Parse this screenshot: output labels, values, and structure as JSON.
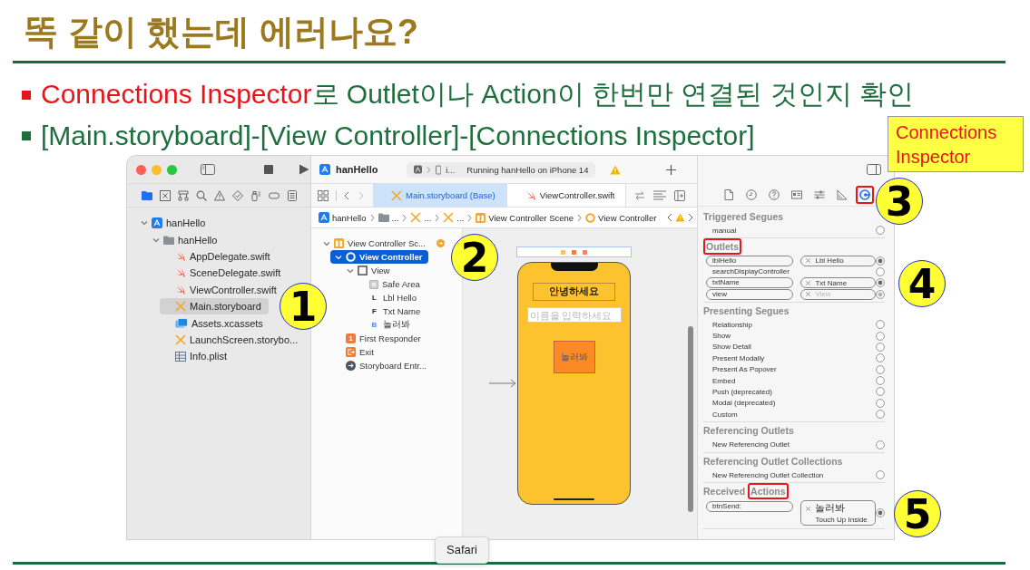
{
  "slide": {
    "title": "똑 같이 했는데 에러나요**?**",
    "bullets": [
      {
        "color": "#e8141b",
        "parts": [
          {
            "text": "Connections Inspector",
            "highlighted": true
          },
          {
            "text": "로 Outlet이나 Action이 한번만 연결된 것인지 확인",
            "highlighted": false
          }
        ]
      },
      {
        "color": "#1f6e3d",
        "parts": [
          {
            "text": "[Main.storyboard]-[View Controller]-[Connections Inspector]",
            "highlighted": false
          }
        ]
      }
    ]
  },
  "callout": "Connections Inspector",
  "markers": [
    "1",
    "2",
    "3",
    "4",
    "5"
  ],
  "xcode": {
    "navigator": {
      "tabs": [
        {
          "kind": "folder",
          "selected": true
        },
        {
          "kind": "square-x",
          "selected": false
        },
        {
          "kind": "hierarchy",
          "selected": false
        },
        {
          "kind": "search",
          "selected": false
        },
        {
          "kind": "warning",
          "selected": false
        },
        {
          "kind": "diamond",
          "selected": false
        },
        {
          "kind": "spray",
          "selected": false
        },
        {
          "kind": "capsule",
          "selected": false
        },
        {
          "kind": "list",
          "selected": false
        }
      ],
      "tree": [
        {
          "label": "hanHello",
          "kind": "project",
          "expanded": true,
          "selected": false,
          "children": [
            {
              "label": "hanHello",
              "kind": "folder",
              "expanded": true,
              "selected": false,
              "children": [
                {
                  "label": "AppDelegate.swift",
                  "kind": "swift",
                  "selected": false
                },
                {
                  "label": "SceneDelegate.swift",
                  "kind": "swift",
                  "selected": false
                },
                {
                  "label": "ViewController.swift",
                  "kind": "swift",
                  "selected": false
                },
                {
                  "label": "Main.storyboard",
                  "kind": "storyboard",
                  "selected": true
                },
                {
                  "label": "Assets.xcassets",
                  "kind": "assets",
                  "selected": false
                },
                {
                  "label": "LaunchScreen.storybo...",
                  "kind": "storyboard",
                  "selected": false
                },
                {
                  "label": "Info.plist",
                  "kind": "plist",
                  "selected": false
                }
              ]
            }
          ]
        }
      ]
    },
    "toolbar": {
      "project": "hanHello",
      "device": "i...",
      "status": "Running hanHello on iPhone 14"
    },
    "tabs": [
      {
        "label": "Main.storyboard (Base)",
        "kind": "storyboard",
        "selected": true
      },
      {
        "label": "ViewController.swift",
        "kind": "swift",
        "selected": false
      }
    ],
    "breadcrumb": [
      {
        "label": "hanHello",
        "kind": "project"
      },
      {
        "label": "...",
        "kind": "folder"
      },
      {
        "label": "...",
        "kind": "storyboard"
      },
      {
        "label": "...",
        "kind": "storyboard"
      },
      {
        "label": "View Controller Scene",
        "kind": "scene"
      },
      {
        "label": "View Controller",
        "kind": "controller"
      }
    ],
    "outline": [
      {
        "label": "View Controller Sc...",
        "kind": "scene",
        "expanded": true,
        "selected": false,
        "children": [
          {
            "label": "View Controller",
            "kind": "controller",
            "expanded": true,
            "selected": true,
            "children": [
              {
                "label": "View",
                "kind": "view",
                "expanded": true,
                "selected": false,
                "children": [
                  {
                    "label": "Safe Area",
                    "kind": "safe-area",
                    "selected": false
                  },
                  {
                    "label": "Lbl Hello",
                    "kind": "label",
                    "badge": "L",
                    "selected": false
                  },
                  {
                    "label": "Txt Name",
                    "kind": "field",
                    "badge": "F",
                    "selected": false
                  },
                  {
                    "label": "놀러봐",
                    "kind": "button",
                    "badge": "B",
                    "selected": false
                  }
                ]
              }
            ]
          },
          {
            "label": "First Responder",
            "kind": "responder",
            "badge": "1",
            "selected": false
          },
          {
            "label": "Exit",
            "kind": "exit",
            "selected": false
          },
          {
            "label": "Storyboard Entr...",
            "kind": "entry",
            "selected": false
          }
        ]
      }
    ],
    "scene": {
      "label": "안녕하세요",
      "placeholder": "이름을 입력하세요",
      "button": "놀러봐"
    },
    "inspector": {
      "tabs": [
        {
          "kind": "file",
          "selected": false,
          "highlighted": false
        },
        {
          "kind": "history",
          "selected": false,
          "highlighted": false
        },
        {
          "kind": "help",
          "selected": false,
          "highlighted": false
        },
        {
          "kind": "identity",
          "selected": false,
          "highlighted": false
        },
        {
          "kind": "attributes",
          "selected": false,
          "highlighted": false
        },
        {
          "kind": "size",
          "selected": false,
          "highlighted": false
        },
        {
          "kind": "connections",
          "selected": true,
          "highlighted": true
        }
      ],
      "sections": [
        {
          "title_parts": [
            {
              "text": "Triggered Segues",
              "highlighted": false
            }
          ],
          "rows": [
            {
              "kind": "plain",
              "label": "manual",
              "disabled": false
            }
          ]
        },
        {
          "title_parts": [
            {
              "text": "Outlets",
              "highlighted": true
            }
          ],
          "rows": [
            {
              "kind": "connected",
              "label": "lblHello",
              "target": "Lbl Hello",
              "disabled": false
            },
            {
              "kind": "plain",
              "label": "searchDisplayController",
              "disabled": false
            },
            {
              "kind": "connected",
              "label": "txtName",
              "target": "Txt Name",
              "disabled": false
            },
            {
              "kind": "connected",
              "label": "view",
              "target": "View",
              "disabled": true
            }
          ]
        },
        {
          "title_parts": [
            {
              "text": "Presenting Segues",
              "highlighted": false
            }
          ],
          "rows": [
            {
              "kind": "plain",
              "label": "Relationship",
              "disabled": false
            },
            {
              "kind": "plain",
              "label": "Show",
              "disabled": false
            },
            {
              "kind": "plain",
              "label": "Show Detail",
              "disabled": false
            },
            {
              "kind": "plain",
              "label": "Present Modally",
              "disabled": false
            },
            {
              "kind": "plain",
              "label": "Present As Popover",
              "disabled": false
            },
            {
              "kind": "plain",
              "label": "Embed",
              "disabled": false
            },
            {
              "kind": "plain",
              "label": "Push (deprecated)",
              "disabled": false
            },
            {
              "kind": "plain",
              "label": "Modal (deprecated)",
              "disabled": false
            },
            {
              "kind": "plain",
              "label": "Custom",
              "disabled": false
            }
          ]
        },
        {
          "title_parts": [
            {
              "text": "Referencing Outlets",
              "highlighted": false
            }
          ],
          "rows": [
            {
              "kind": "plain",
              "label": "New Referencing Outlet",
              "disabled": false
            }
          ]
        },
        {
          "title_parts": [
            {
              "text": "Referencing Outlet Collections",
              "highlighted": false
            }
          ],
          "rows": [
            {
              "kind": "plain",
              "label": "New Referencing Outlet Collection",
              "disabled": false
            }
          ]
        },
        {
          "title_parts": [
            {
              "text": "Received",
              "highlighted": false
            },
            {
              "text": "Actions",
              "highlighted": true
            }
          ],
          "rows": [
            {
              "kind": "action",
              "label": "btnSend:",
              "target": "놀러봐",
              "event": "Touch Up Inside",
              "disabled": false
            }
          ]
        }
      ]
    }
  },
  "tooltip": "Safari"
}
